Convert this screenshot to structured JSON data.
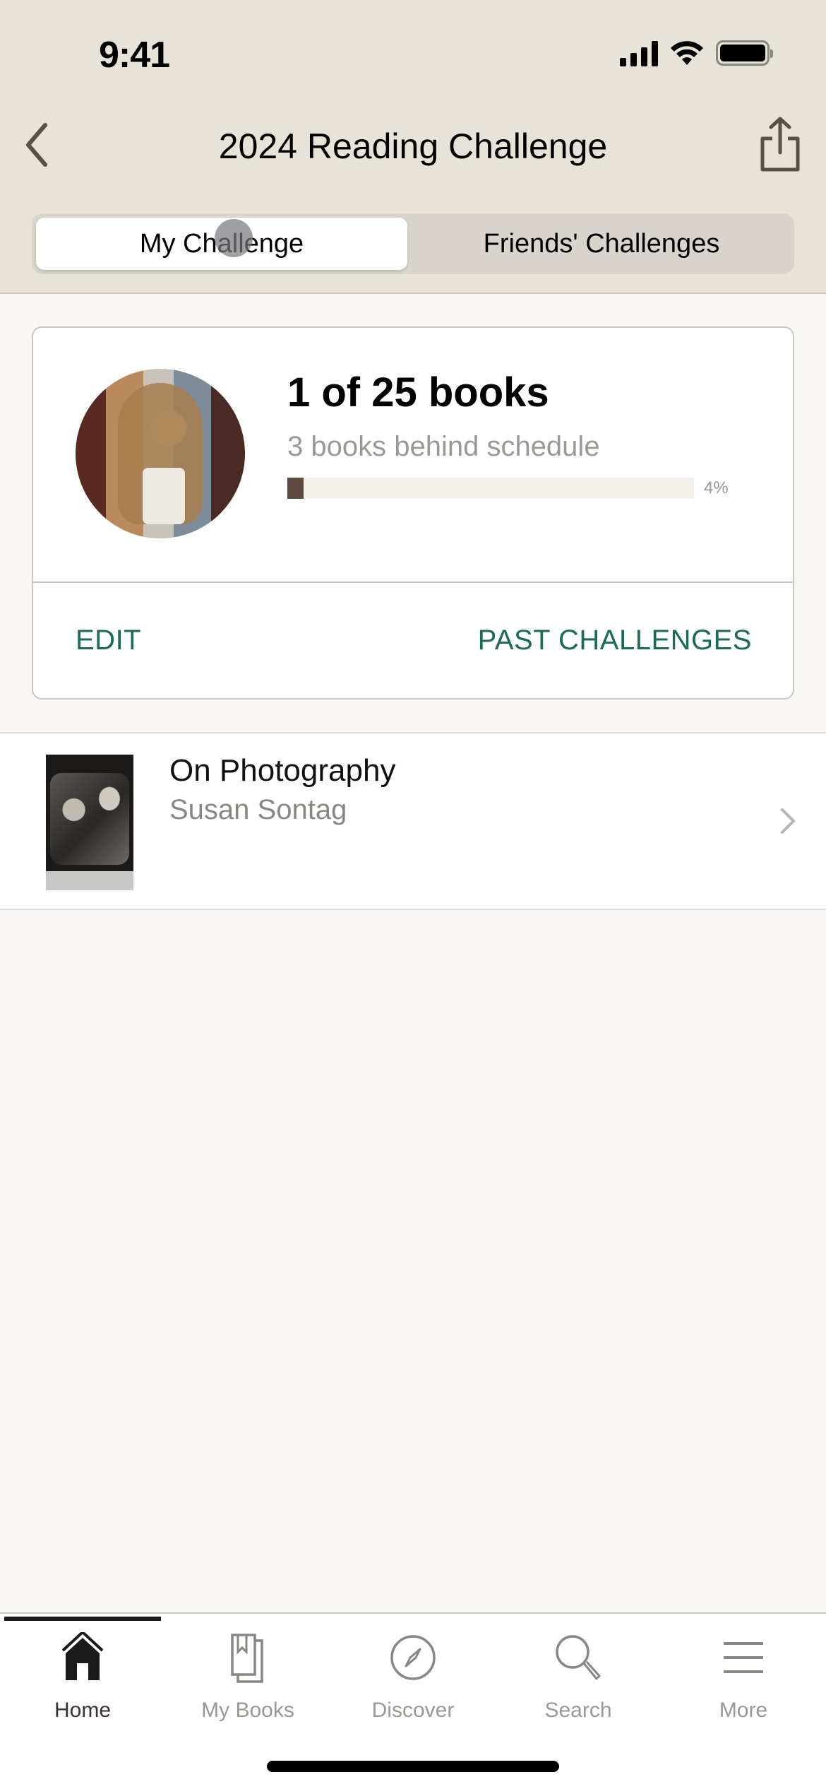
{
  "status_bar": {
    "time": "9:41"
  },
  "nav": {
    "title": "2024 Reading Challenge",
    "back_icon": "chevron-left-icon",
    "share_icon": "share-icon"
  },
  "segmented_control": {
    "tabs": [
      {
        "label": "My Challenge",
        "selected": true
      },
      {
        "label": "Friends' Challenges",
        "selected": false
      }
    ]
  },
  "challenge_card": {
    "avatar_icon": "user-avatar",
    "goal_text": "1 of 25 books",
    "books_read": 1,
    "books_goal": 25,
    "schedule_text": "3 books behind schedule",
    "progress_percent": 4,
    "progress_label": "4%",
    "actions": {
      "edit": "EDIT",
      "past": "PAST CHALLENGES"
    }
  },
  "books": [
    {
      "title": "On Photography",
      "author": "Susan Sontag"
    }
  ],
  "tabbar": {
    "items": [
      {
        "label": "Home",
        "icon": "home-icon",
        "active": true
      },
      {
        "label": "My Books",
        "icon": "books-icon",
        "active": false
      },
      {
        "label": "Discover",
        "icon": "compass-icon",
        "active": false
      },
      {
        "label": "Search",
        "icon": "search-icon",
        "active": false
      },
      {
        "label": "More",
        "icon": "menu-icon",
        "active": false
      }
    ]
  },
  "colors": {
    "header_bg": "#e8e3d8",
    "accent_green": "#1b6b58",
    "progress_fill": "#5f4a42",
    "progress_track": "#f4f1ec",
    "page_bg": "#f8f7f4"
  }
}
